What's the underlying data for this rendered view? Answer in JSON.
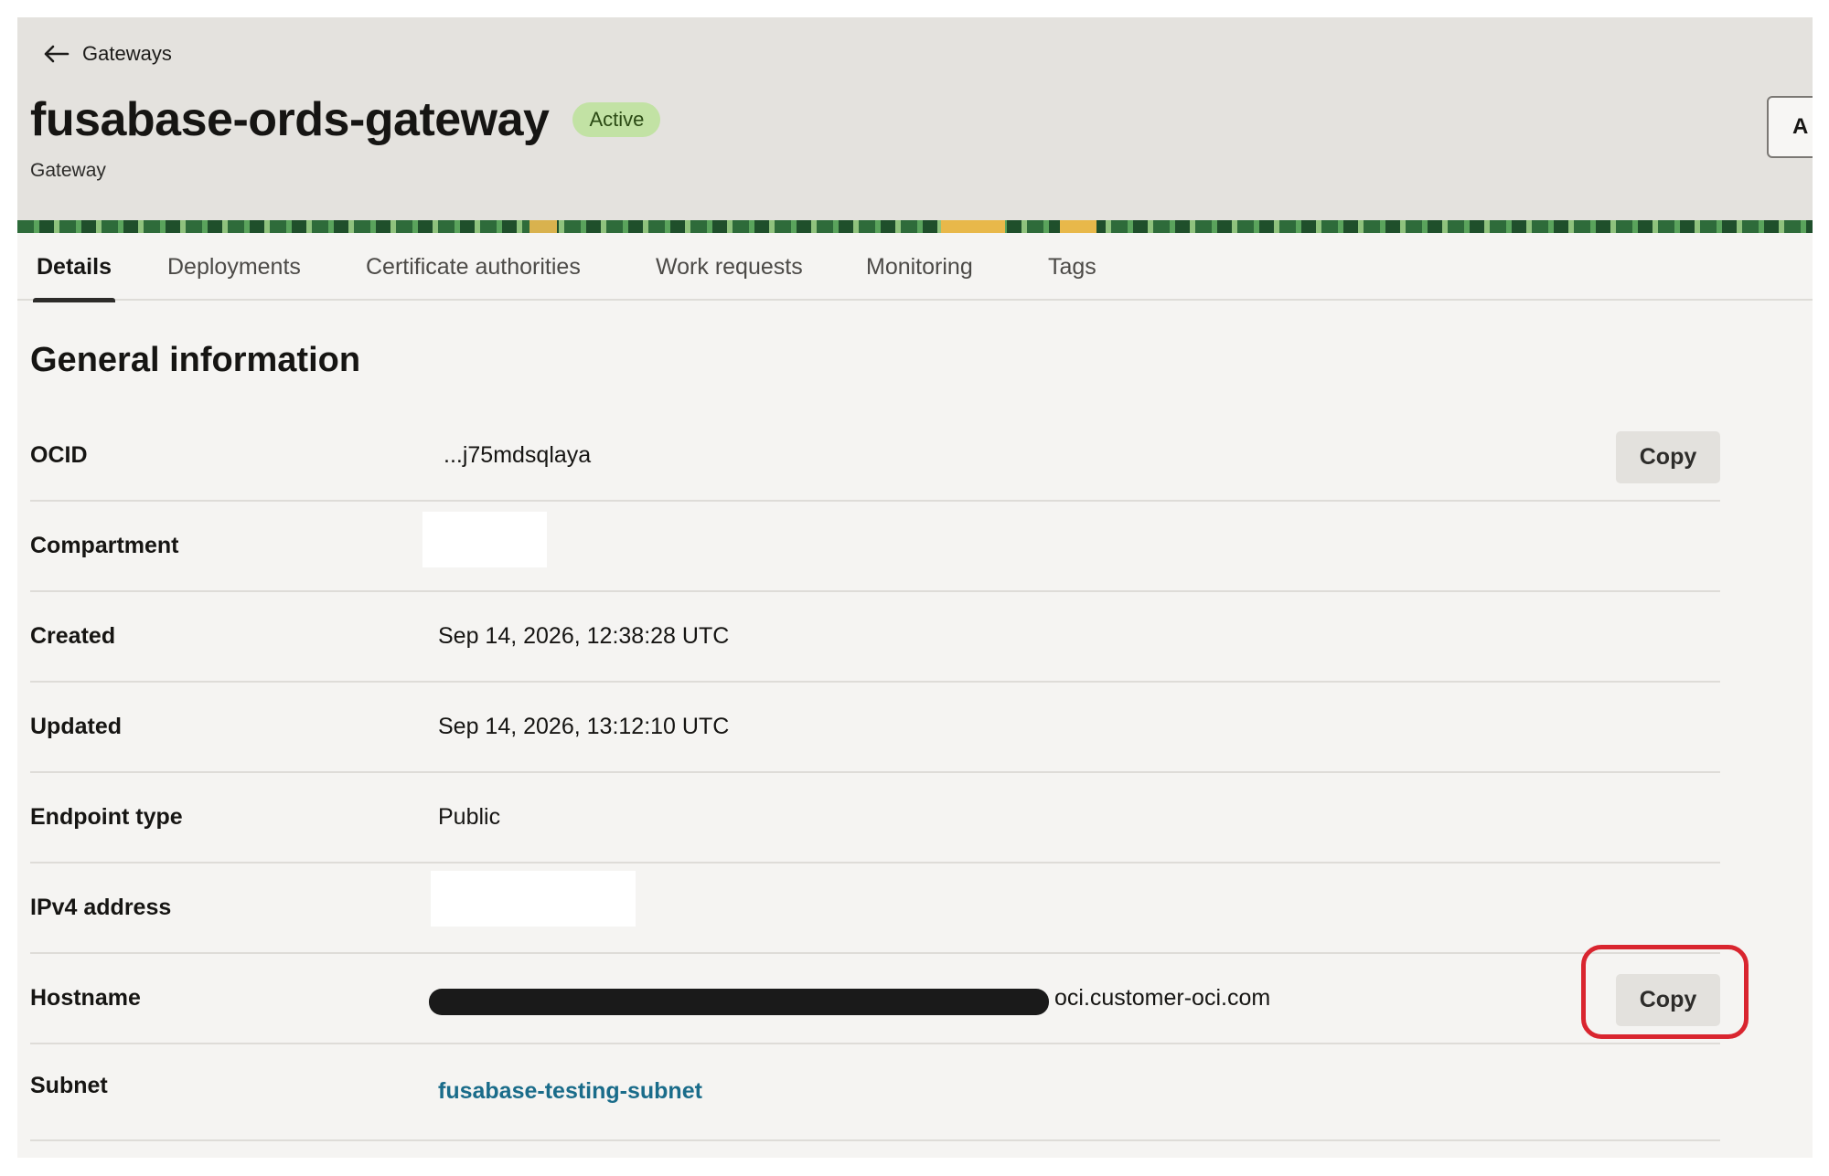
{
  "header": {
    "back_label": "Gateways",
    "title": "fusabase-ords-gateway",
    "status": "Active",
    "subtitle": "Gateway",
    "action_button_label": "A"
  },
  "tabs": [
    {
      "label": "Details",
      "active": true
    },
    {
      "label": "Deployments",
      "active": false
    },
    {
      "label": "Certificate authorities",
      "active": false
    },
    {
      "label": "Work requests",
      "active": false
    },
    {
      "label": "Monitoring",
      "active": false
    },
    {
      "label": "Tags",
      "active": false
    }
  ],
  "section": {
    "title": "General information",
    "copy_label": "Copy",
    "rows": {
      "ocid": {
        "label": "OCID",
        "value": "...j75mdsqlaya"
      },
      "compartment": {
        "label": "Compartment",
        "value": ""
      },
      "created": {
        "label": "Created",
        "value": "Sep 14, 2026, 12:38:28 UTC"
      },
      "updated": {
        "label": "Updated",
        "value": "Sep 14, 2026, 13:12:10 UTC"
      },
      "endpoint_type": {
        "label": "Endpoint type",
        "value": "Public"
      },
      "ipv4": {
        "label": "IPv4 address",
        "value": ""
      },
      "hostname": {
        "label": "Hostname",
        "value": "oci.customer-oci.com"
      },
      "subnet": {
        "label": "Subnet",
        "value": "fusabase-testing-subnet"
      }
    }
  },
  "colors": {
    "status_badge_bg": "#c2e2a4",
    "link": "#1a6c8a",
    "highlight": "#d9252f"
  }
}
